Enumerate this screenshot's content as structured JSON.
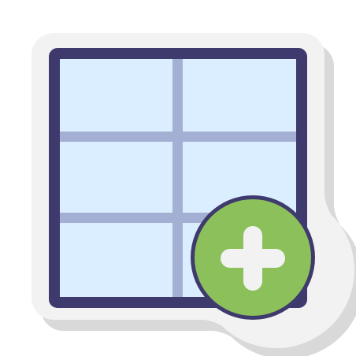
{
  "icon": {
    "name": "add-table-icon",
    "style": "sticker"
  },
  "table": {
    "rows": 3,
    "columns": 2
  },
  "colors": {
    "background": "#ffffff",
    "sticker_shadow": "#d9d9d9",
    "sticker_body": "#f2f2f2",
    "table_border": "#3f3a6e",
    "table_cells": "#dbeeff",
    "grid_lines": "#a4b0d3",
    "plus_circle": "#8cc05a",
    "plus_sign": "#f2f2f2"
  }
}
